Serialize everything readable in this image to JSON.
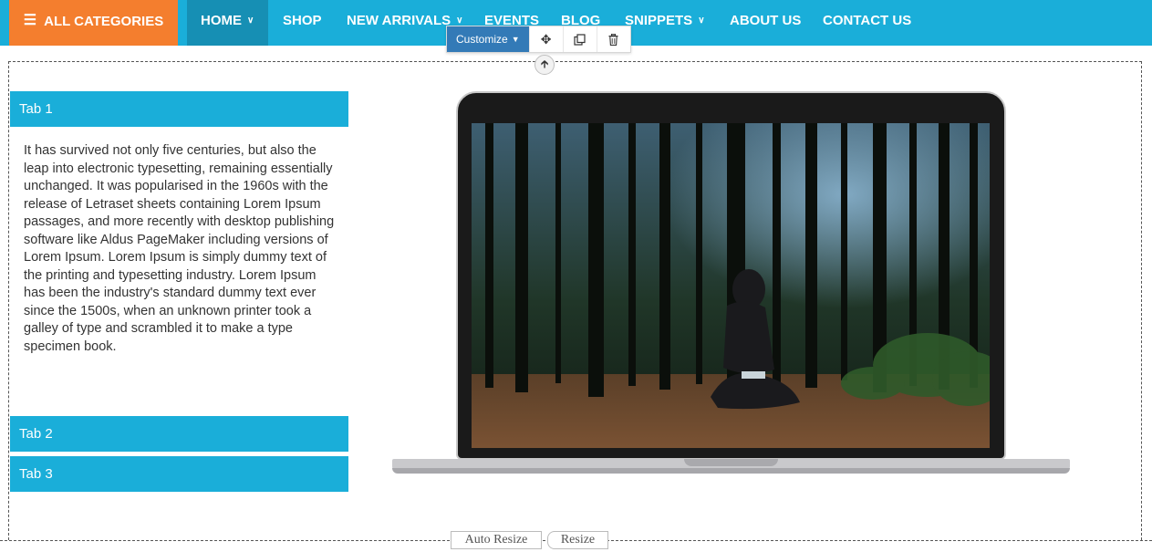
{
  "nav": {
    "categories_label": "ALL CATEGORIES",
    "items": [
      {
        "label": "HOME",
        "dropdown": true,
        "active": true
      },
      {
        "label": "SHOP",
        "dropdown": false
      },
      {
        "label": "NEW ARRIVALS",
        "dropdown": true
      },
      {
        "label": "EVENTS",
        "dropdown": false
      },
      {
        "label": "BLOG",
        "dropdown": false
      },
      {
        "label": "SNIPPETS",
        "dropdown": true
      },
      {
        "label": "ABOUT US",
        "dropdown": false
      },
      {
        "label": "CONTACT US",
        "dropdown": false
      }
    ]
  },
  "toolbar": {
    "customize_label": "Customize",
    "icons": [
      "move-icon",
      "duplicate-icon",
      "delete-icon"
    ]
  },
  "tabs": [
    {
      "label": "Tab 1",
      "expanded": true,
      "body": "It has survived not only five centuries, but also the leap into electronic typesetting, remaining essentially unchanged. It was popularised in the 1960s with the release of Letraset sheets containing Lorem Ipsum passages, and more recently with desktop publishing software like Aldus PageMaker including versions of Lorem Ipsum. Lorem Ipsum is simply dummy text of the printing and typesetting industry. Lorem Ipsum has been the industry's standard dummy text ever since the 1500s, when an unknown printer took a galley of type and scrambled it to make a type specimen book."
    },
    {
      "label": "Tab 2",
      "expanded": false
    },
    {
      "label": "Tab 3",
      "expanded": false
    }
  ],
  "resize": {
    "auto_label": "Auto Resize",
    "resize_label": "Resize"
  },
  "colors": {
    "nav_bg": "#1aaed9",
    "nav_active": "#168fb4",
    "category_orange": "#f47e2e",
    "customize_blue": "#337ab7"
  }
}
